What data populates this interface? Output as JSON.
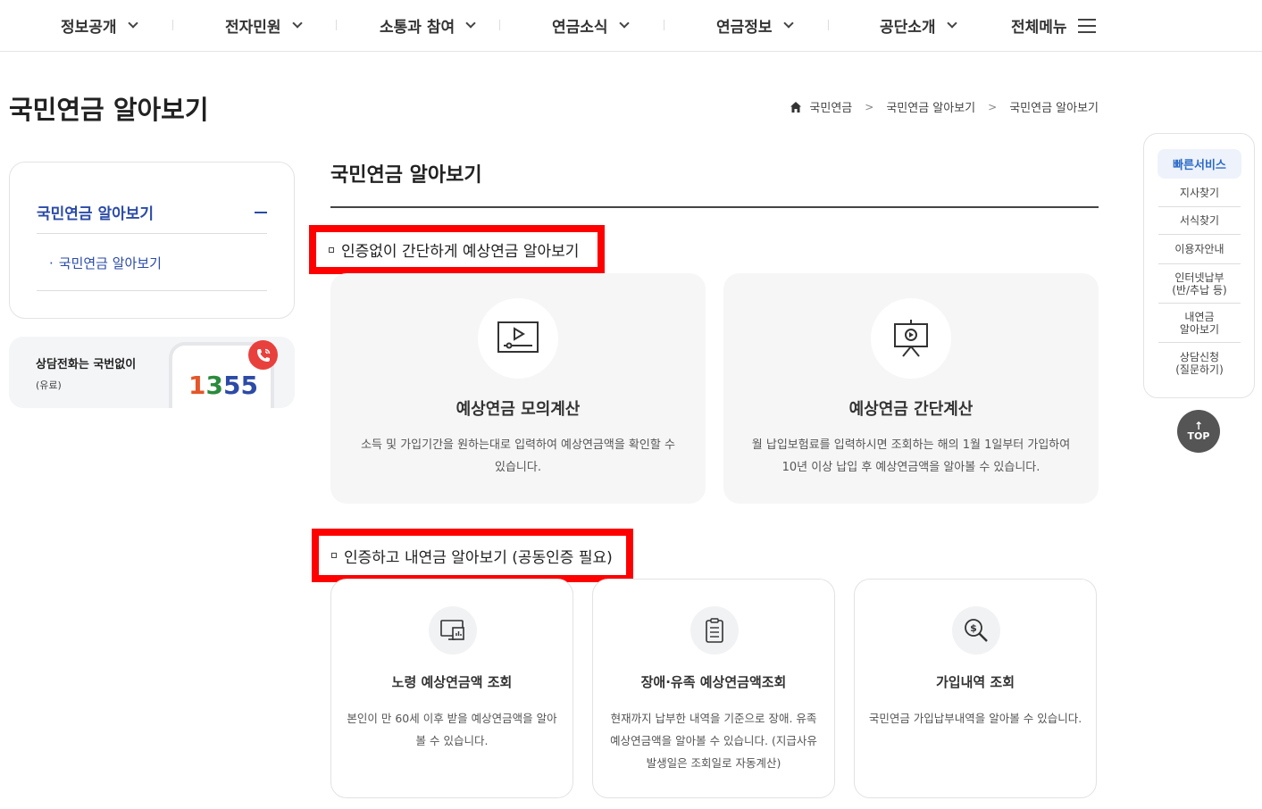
{
  "nav": {
    "items": [
      {
        "label": "정보공개"
      },
      {
        "label": "전자민원"
      },
      {
        "label": "소통과 참여"
      },
      {
        "label": "연금소식"
      },
      {
        "label": "연금정보"
      },
      {
        "label": "공단소개"
      }
    ],
    "all_menu": "전체메뉴"
  },
  "page_title": "국민연금 알아보기",
  "breadcrumb": [
    "국민연금",
    "국민연금 알아보기",
    "국민연금 알아보기"
  ],
  "sidebar": {
    "title": "국민연금 알아보기",
    "sub_item": "국민연금 알아보기",
    "call_title": "상담전화는 국번없이",
    "call_sub": "(유료)",
    "call_number_a": "1",
    "call_number_b": "3",
    "call_number_c": "55"
  },
  "main": {
    "title": "국민연금 알아보기",
    "section1": "인증없이 간단하게 예상연금 알아보기",
    "section2": "인증하고 내연금 알아보기 (공동인증 필요)",
    "cards_big": [
      {
        "title": "예상연금 모의계산",
        "desc": "소득 및 가입기간을 원하는대로 입력하여 예상연금액을 확인할 수 있습니다.",
        "icon": "video-player-icon"
      },
      {
        "title": "예상연금 간단계산",
        "desc": "월 납입보험료를 입력하시면 조회하는 해의 1월 1일부터 가입하여 10년 이상 납입 후 예상연금액을 알아볼 수 있습니다.",
        "icon": "presentation-board-icon"
      }
    ],
    "cards_small": [
      {
        "title": "노령 예상연금액 조회",
        "desc": "본인이 만 60세 이후 받을 예상연금액을 알아볼 수 있습니다.",
        "icon": "monitor-chart-icon"
      },
      {
        "title": "장애·유족 예상연금액조회",
        "desc": "현재까지 납부한 내역을 기준으로 장애. 유족 예상연금액을 알아볼 수 있습니다. (지급사유발생일은 조회일로 자동계산)",
        "icon": "clipboard-icon"
      },
      {
        "title": "가입내역 조회",
        "desc": "국민연금 가입납부내역을 알아볼 수 있습니다.",
        "icon": "dollar-search-icon"
      }
    ]
  },
  "quick": {
    "title": "빠른서비스",
    "items": [
      "지사찾기",
      "서식찾기",
      "이용자안내",
      "인터넷납부\n(반/추납 등)",
      "내연금\n알아보기",
      "상담신청\n(질문하기)"
    ],
    "top": "TOP"
  },
  "colors": {
    "accent": "#2b4ba8",
    "highlight_border": "#ff0000",
    "call_badge": "#e8413d"
  }
}
